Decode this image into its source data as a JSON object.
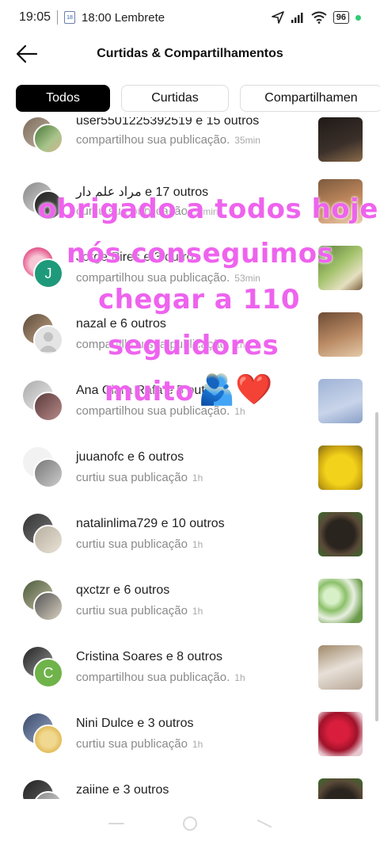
{
  "status": {
    "time": "19:05",
    "calendar_day": "18",
    "reminder": "18:00 Lembrete",
    "battery": "96",
    "icons": [
      "location-icon",
      "signal-icon",
      "wifi-icon",
      "battery-icon"
    ]
  },
  "header": {
    "title": "Curtidas & Compartilhamentos"
  },
  "tabs": [
    {
      "label": "Todos",
      "active": true
    },
    {
      "label": "Curtidas",
      "active": false
    },
    {
      "label": "Compartilhamen",
      "active": false
    }
  ],
  "notifications": [
    {
      "title": "user5501225392519 e 15 outros",
      "action": "compartilhou sua publicação.",
      "time": "35min"
    },
    {
      "title": "مراد علم دار e 17 outros",
      "action": "curtiu sua publicação",
      "time": "53min"
    },
    {
      "title": "Jorge Pires e 3 outros",
      "action": "compartilhou sua publicação.",
      "time": "53min",
      "avatar_letter": "J"
    },
    {
      "title": "nazal e 6 outros",
      "action": "compartilhou sua publicação.",
      "time": "1h"
    },
    {
      "title": "Ana Clara Rafa e 5 outros",
      "action": "compartilhou sua publicação.",
      "time": "1h"
    },
    {
      "title": "juuanofc e 6 outros",
      "action": "curtiu sua publicação",
      "time": "1h"
    },
    {
      "title": "natalinlima729 e 10 outros",
      "action": "curtiu sua publicação",
      "time": "1h"
    },
    {
      "title": "qxctzr e 6 outros",
      "action": "curtiu sua publicação",
      "time": "1h"
    },
    {
      "title": "Cristina Soares e 8 outros",
      "action": "compartilhou sua publicação.",
      "time": "1h",
      "avatar_letter": "C"
    },
    {
      "title": "Nini Dulce e 3 outros",
      "action": "curtiu sua publicação",
      "time": "1h"
    },
    {
      "title": "zaiine e 3 outros",
      "action": "",
      "time": ""
    }
  ],
  "overlay": {
    "lines": [
      "obrigado a todos hoje",
      "nós conseguimos",
      "chegar a 110",
      "seguidores",
      "muito"
    ],
    "emoji": "🫂❤️"
  },
  "colors": {
    "overlay_text": "#ee63ee",
    "avatar_j": "#1e9a7a",
    "avatar_c": "#6fb34a",
    "tab_active_bg": "#000000"
  }
}
